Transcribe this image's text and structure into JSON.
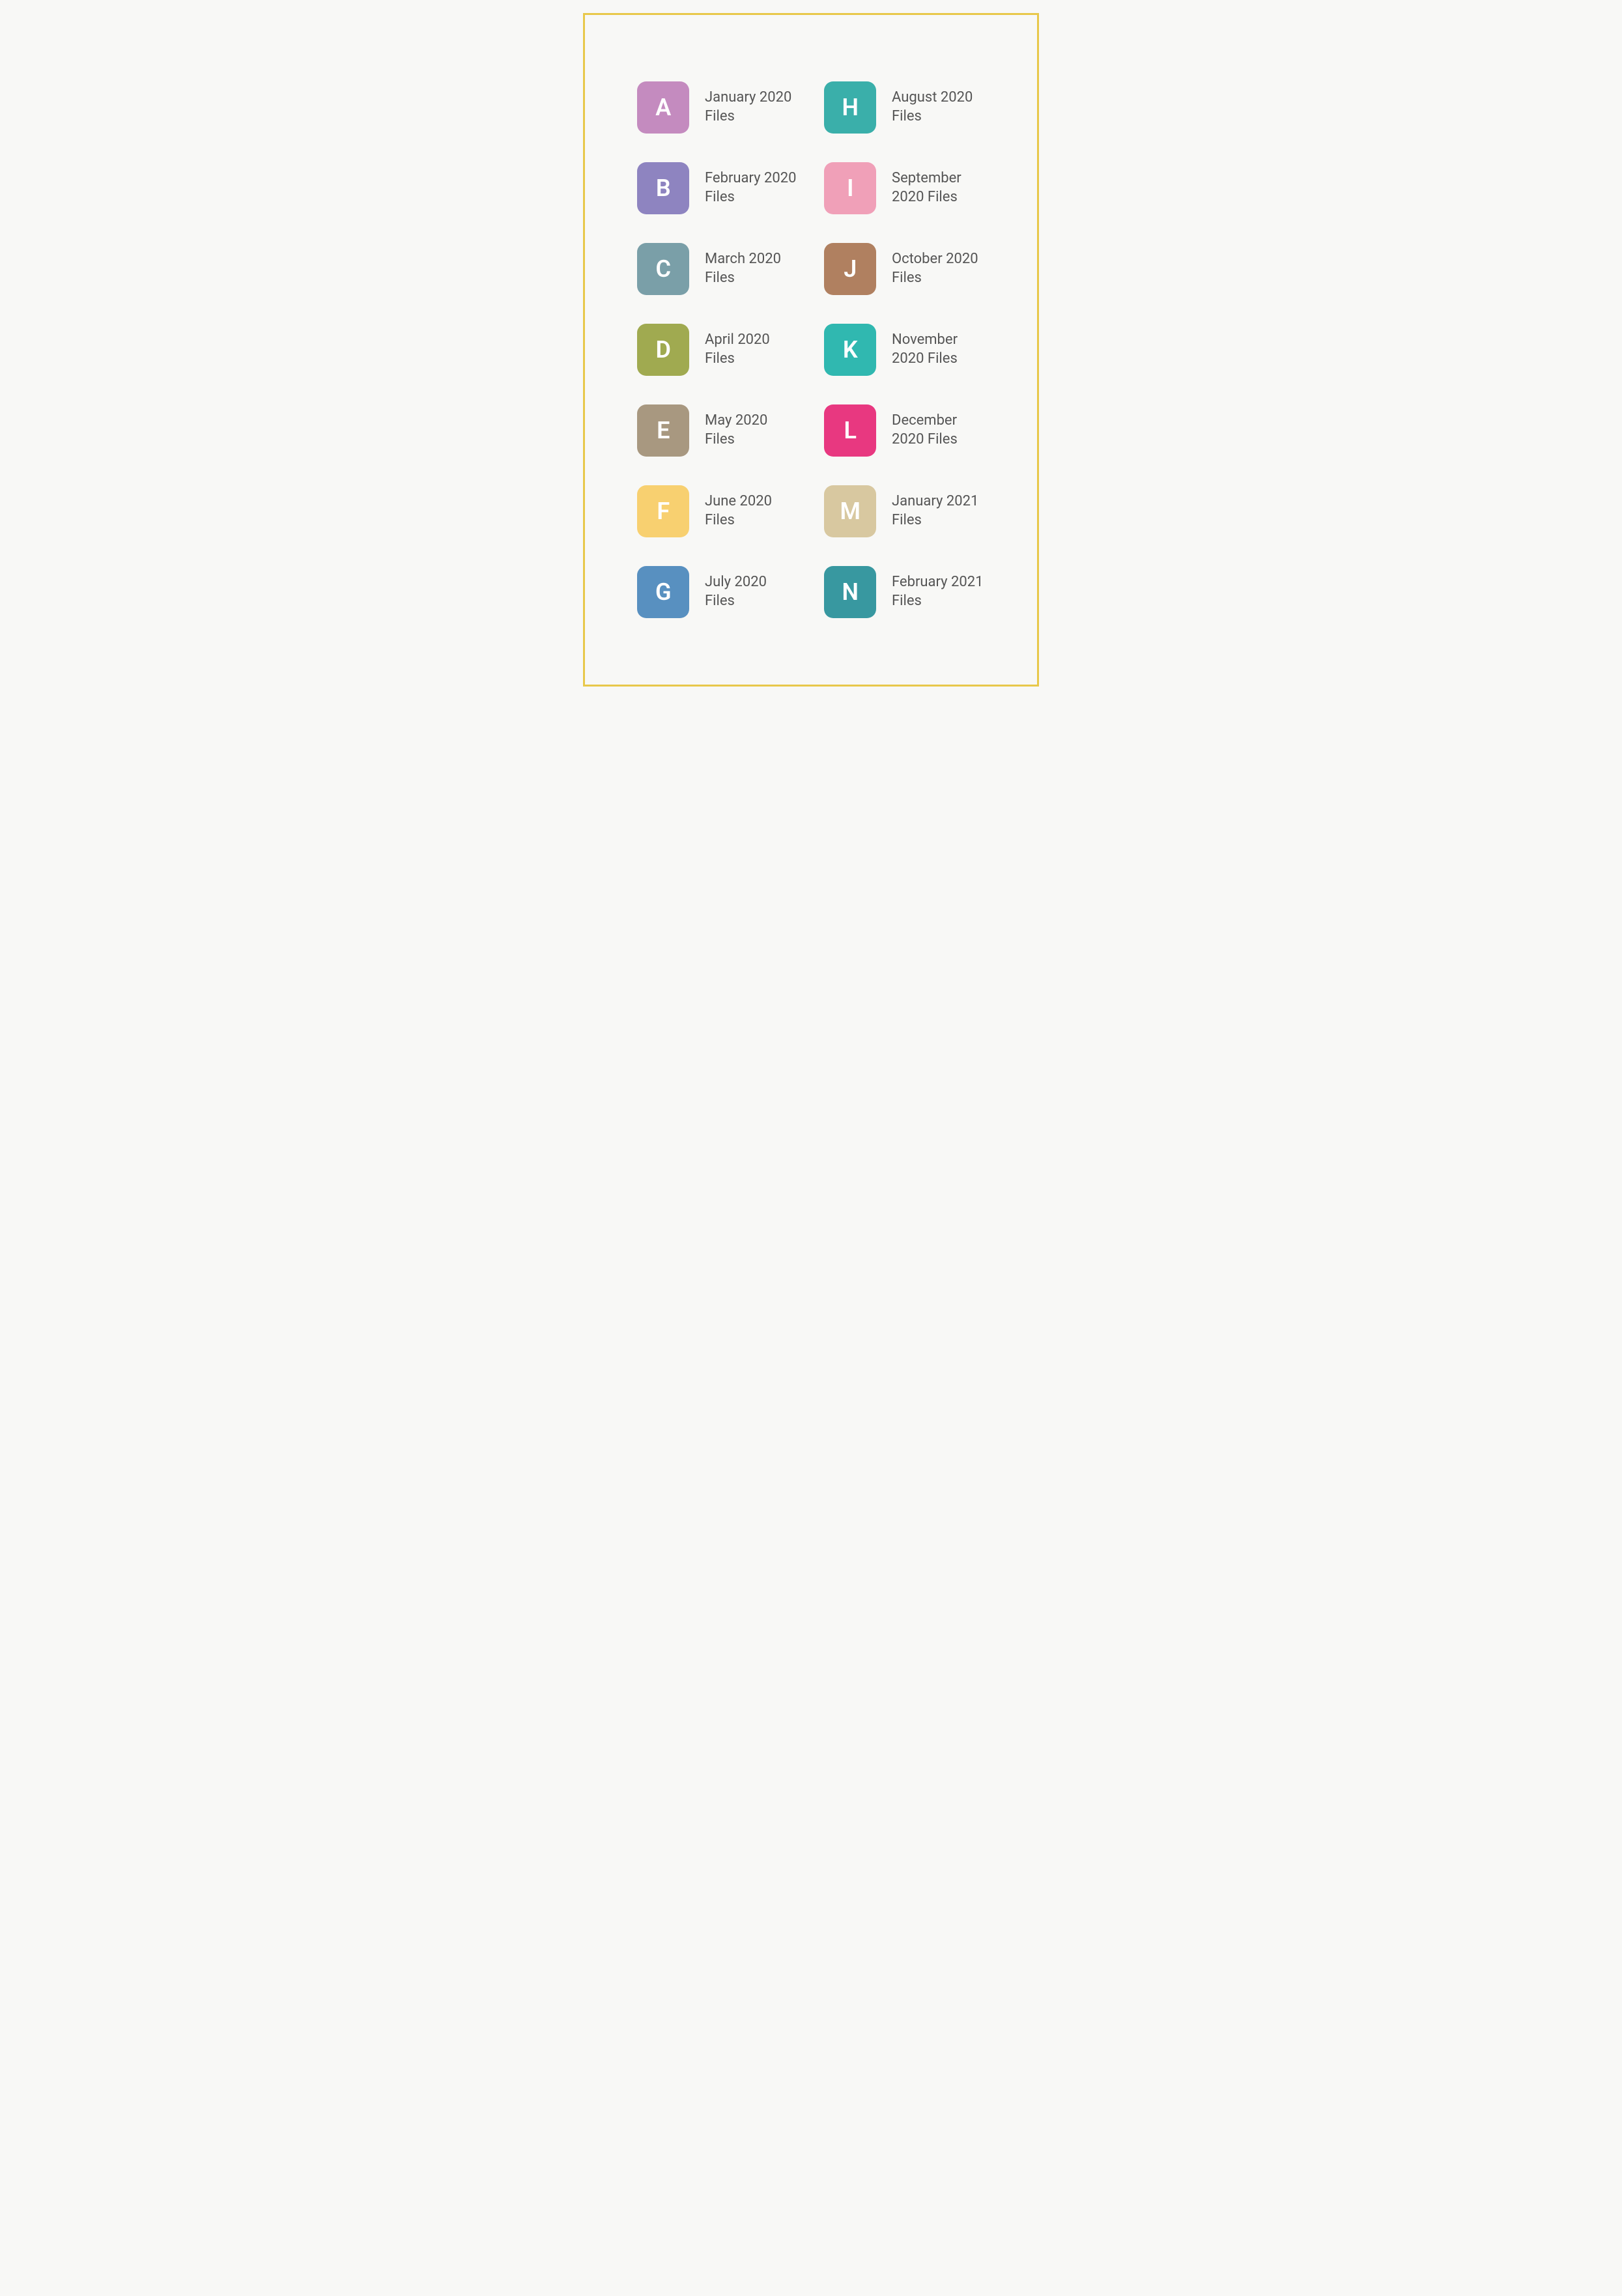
{
  "items": [
    {
      "letter": "A",
      "label": "January 2020 Files",
      "color": "#c48bbf"
    },
    {
      "letter": "H",
      "label": "August 2020 Files",
      "color": "#3aafaa"
    },
    {
      "letter": "B",
      "label": "February 2020 Files",
      "color": "#8e84c0"
    },
    {
      "letter": "I",
      "label": "September 2020 Files",
      "color": "#f0a0b8"
    },
    {
      "letter": "C",
      "label": "March 2020 Files",
      "color": "#7a9fa8"
    },
    {
      "letter": "J",
      "label": "October 2020 Files",
      "color": "#b08060"
    },
    {
      "letter": "D",
      "label": "April 2020 Files",
      "color": "#a0aa50"
    },
    {
      "letter": "K",
      "label": "November 2020 Files",
      "color": "#30b8b0"
    },
    {
      "letter": "E",
      "label": "May 2020 Files",
      "color": "#a89880"
    },
    {
      "letter": "L",
      "label": "December 2020 Files",
      "color": "#e83880"
    },
    {
      "letter": "F",
      "label": "June 2020 Files",
      "color": "#f8d070"
    },
    {
      "letter": "M",
      "label": "January 2021 Files",
      "color": "#d8c8a0"
    },
    {
      "letter": "G",
      "label": "July 2020 Files",
      "color": "#5890c0"
    },
    {
      "letter": "N",
      "label": "February 2021 Files",
      "color": "#3898a0"
    }
  ]
}
